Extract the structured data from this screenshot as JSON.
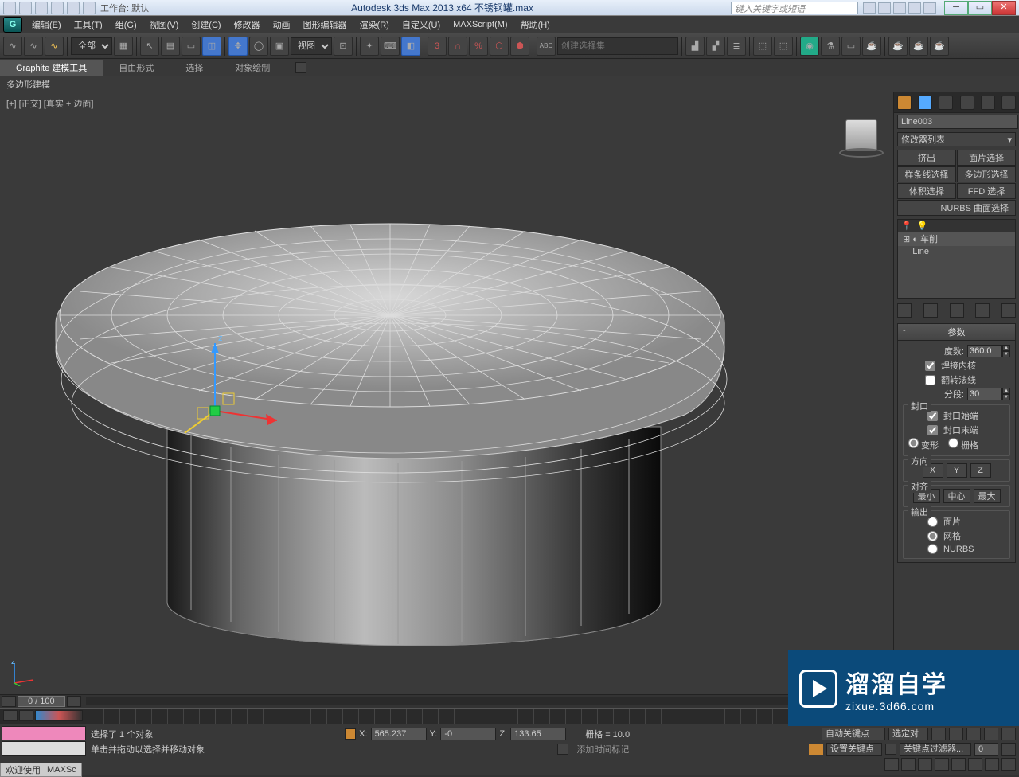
{
  "titlebar": {
    "workspace_label": "工作台: 默认",
    "app_title": "Autodesk 3ds Max  2013 x64    不锈钢罐.max",
    "search_placeholder": "键入关键字或短语"
  },
  "menu": {
    "edit": "编辑(E)",
    "tools": "工具(T)",
    "group": "组(G)",
    "views": "视图(V)",
    "create": "创建(C)",
    "modifiers": "修改器",
    "animation": "动画",
    "graph": "图形编辑器",
    "rendering": "渲染(R)",
    "customize": "自定义(U)",
    "maxscript": "MAXScript(M)",
    "help": "帮助(H)"
  },
  "toolbar": {
    "all": "全部",
    "view": "视图",
    "selset": "创建选择集"
  },
  "ribbon": {
    "tab1": "Graphite 建模工具",
    "tab2": "自由形式",
    "tab3": "选择",
    "tab4": "对象绘制",
    "sub": "多边形建模"
  },
  "viewport": {
    "label": "[+] [正交] [真实 + 边面]"
  },
  "right": {
    "objname": "Line003",
    "modlist": "修改器列表",
    "btns": {
      "extrude": "挤出",
      "faceSel": "面片选择",
      "splineSel": "样条线选择",
      "polySel": "多边形选择",
      "volSel": "体积选择",
      "ffd": "FFD 选择",
      "nurbs": "NURBS 曲面选择"
    },
    "stack": {
      "mod1": "车削",
      "mod2": "Line"
    },
    "params": {
      "header": "参数",
      "degrees_lbl": "度数:",
      "degrees_val": "360.0",
      "weld": "焊接内核",
      "flip": "翻转法线",
      "segments_lbl": "分段:",
      "segments_val": "30",
      "cap_hdr": "封口",
      "cap_start": "封口始端",
      "cap_end": "封口末端",
      "morph": "变形",
      "grid": "栅格",
      "dir_hdr": "方向",
      "x": "X",
      "y": "Y",
      "z": "Z",
      "align_hdr": "对齐",
      "min": "最小",
      "center": "中心",
      "max": "最大",
      "output_hdr": "输出",
      "patch": "面片",
      "mesh": "网格",
      "nurbs_out": "NURBS"
    }
  },
  "timeline": {
    "frame": "0 / 100"
  },
  "status": {
    "selected": "选择了 1 个对象",
    "hint": "单击并拖动以选择并移动对象",
    "x_lbl": "X:",
    "x": "565.237",
    "y_lbl": "Y:",
    "y": "-0",
    "z_lbl": "Z:",
    "z": "133.65",
    "grid": "栅格 = 10.0",
    "addkey": "添加时间标记",
    "autokey": "自动关键点",
    "setkey": "设置关键点",
    "selected_set": "选定对",
    "keyfilter": "关键点过滤器..."
  },
  "welcome": {
    "w": "欢迎使用",
    "m": "MAXSc"
  },
  "watermark": {
    "big": "溜溜自学",
    "small": "zixue.3d66.com"
  }
}
